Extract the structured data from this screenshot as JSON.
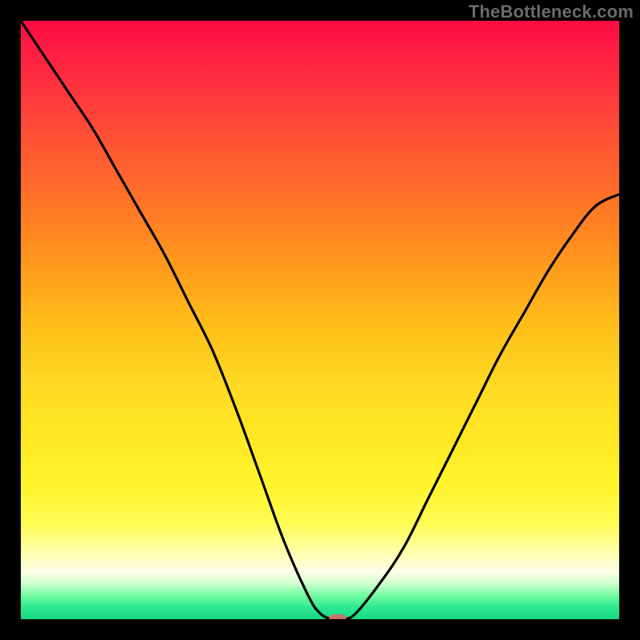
{
  "watermark": "TheBottleneck.com",
  "chart_data": {
    "type": "line",
    "title": "",
    "xlabel": "",
    "ylabel": "",
    "xlim": [
      0,
      100
    ],
    "ylim": [
      0,
      100
    ],
    "grid": false,
    "legend": false,
    "background": "red-yellow-green vertical gradient",
    "series": [
      {
        "name": "bottleneck-curve",
        "x": [
          0,
          4,
          8,
          12,
          16,
          20,
          24,
          28,
          32,
          36,
          40,
          44,
          48,
          50,
          52,
          54,
          56,
          60,
          64,
          68,
          72,
          76,
          80,
          84,
          88,
          92,
          96,
          100
        ],
        "values": [
          100,
          94,
          88,
          82,
          75,
          68,
          61,
          53,
          45,
          35,
          24,
          13,
          4,
          1,
          0,
          0,
          1,
          6,
          12,
          20,
          28,
          36,
          44,
          51,
          58,
          64,
          69,
          71
        ]
      }
    ],
    "marker": {
      "x": 53,
      "y": 0
    },
    "colors": {
      "curve": "#000000",
      "marker": "#d56b68",
      "gradient_top": "#ff0b45",
      "gradient_mid": "#ffe822",
      "gradient_bottom": "#15da84"
    }
  }
}
